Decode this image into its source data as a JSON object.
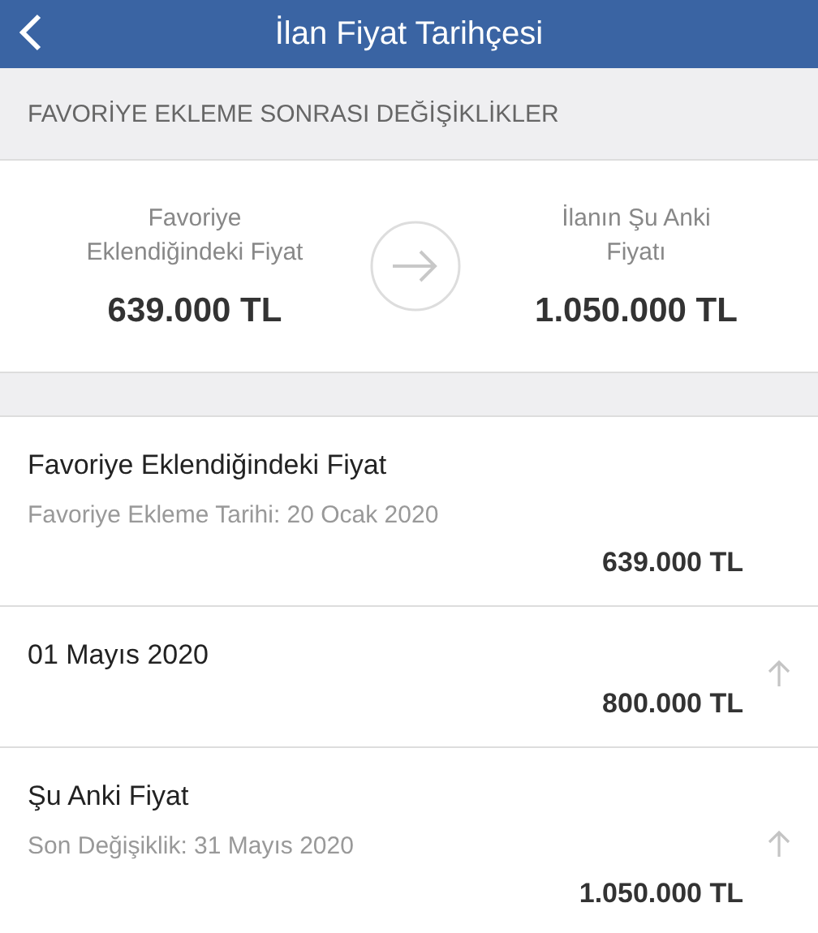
{
  "header": {
    "title": "İlan Fiyat Tarihçesi"
  },
  "section_title": "FAVORİYE EKLEME SONRASI DEĞİŞİKLİKLER",
  "comparison": {
    "left": {
      "label": "Favoriye Eklendiğindeki Fiyat",
      "price": "639.000 TL"
    },
    "right": {
      "label": "İlanın Şu Anki Fiyatı",
      "price": "1.050.000 TL"
    }
  },
  "history": [
    {
      "title": "Favoriye Eklendiğindeki Fiyat",
      "subtitle": "Favoriye Ekleme Tarihi: 20 Ocak 2020",
      "price": "639.000 TL",
      "increased": false
    },
    {
      "title": "01 Mayıs 2020",
      "price": "800.000 TL",
      "increased": true
    },
    {
      "title": "Şu Anki Fiyat",
      "subtitle": "Son Değişiklik: 31 Mayıs 2020",
      "price": "1.050.000 TL",
      "increased": true
    }
  ]
}
